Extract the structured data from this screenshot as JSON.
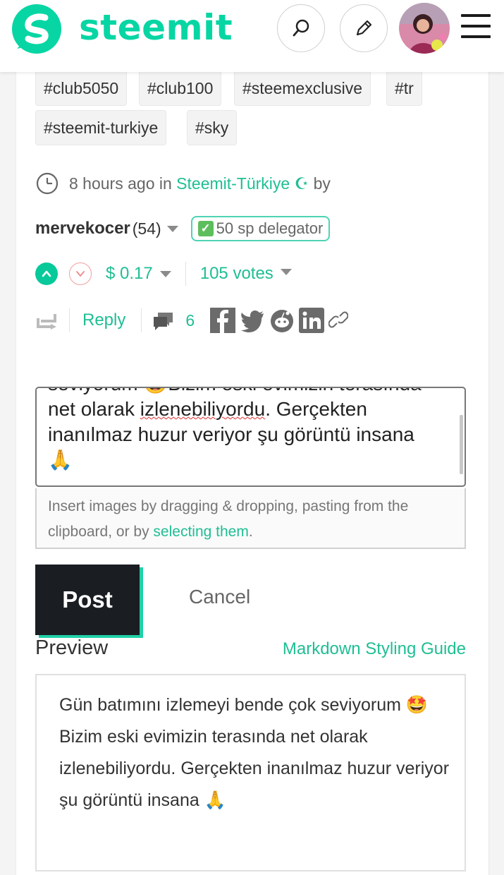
{
  "header": {
    "brand": "steemit",
    "colors": {
      "accent": "#07d6a4",
      "dark": "#1a1e23"
    },
    "icons": [
      "steemit-logo-icon",
      "search-icon",
      "pencil-icon",
      "hamburger-menu-icon"
    ]
  },
  "tags": [
    "#club5050",
    "#club100",
    "#steemexclusive",
    "#tr",
    "#steemit-turkiye",
    "#sky"
  ],
  "meta": {
    "time": "8 hours ago in",
    "community": "Steemit-Türkiye ☪",
    "by": "by"
  },
  "author": {
    "name": "mervekocer",
    "reputation": "(54)",
    "badge_check": "✓",
    "badge_text": "50 sp delegator"
  },
  "votes": {
    "payout": "$ 0.17",
    "count": "105 votes"
  },
  "actions": {
    "reply": "Reply",
    "comments": "6"
  },
  "editor": {
    "line1": "seviyorum 🤩Bizim eski evimizin terasında",
    "line2_pre": "net olarak ",
    "line2_typo": "izlenebiliyordu",
    "line2_post": ". Gerçekten",
    "line3": "inanılmaz huzur veriyor şu görüntü insana",
    "line4": "🙏"
  },
  "dropzone": {
    "text": "Insert images by dragging & dropping, pasting from the clipboard, or by ",
    "link": "selecting them",
    "end": "."
  },
  "buttons": {
    "post": "Post",
    "cancel": "Cancel"
  },
  "preview": {
    "label": "Preview",
    "guide": "Markdown Styling Guide",
    "text": "Gün batımını izlemeyi bende çok seviyorum 🤩Bizim eski evimizin terasında net olarak izlenebiliyordu. Gerçekten inanılmaz huzur veriyor şu görüntü insana 🙏"
  }
}
